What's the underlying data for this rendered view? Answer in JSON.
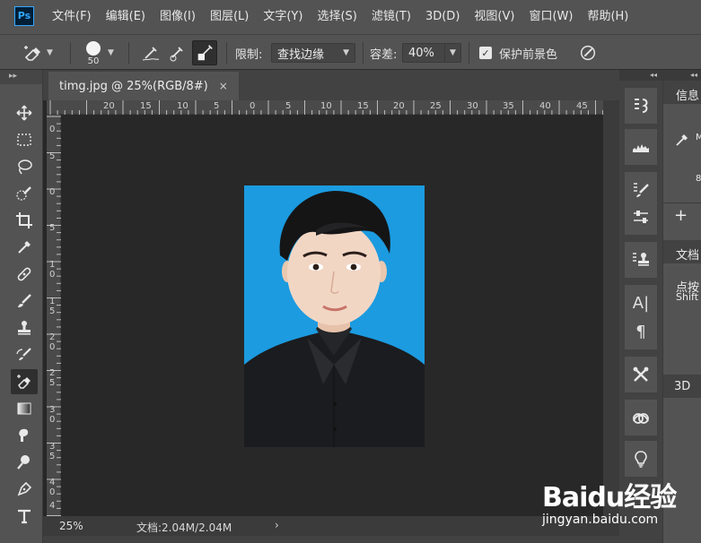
{
  "app": {
    "logo": "Ps"
  },
  "menu": [
    "文件(F)",
    "编辑(E)",
    "图像(I)",
    "图层(L)",
    "文字(Y)",
    "选择(S)",
    "滤镜(T)",
    "3D(D)",
    "视图(V)",
    "窗口(W)",
    "帮助(H)"
  ],
  "options": {
    "brush_size": "50",
    "limit_label": "限制:",
    "limit_value": "查找边缘",
    "tolerance_label": "容差:",
    "tolerance_value": "40%",
    "protect_fg_label": "保护前景色",
    "protect_fg_checked": true
  },
  "toolbar": {
    "collapse": "▸▸"
  },
  "document": {
    "tab_title": "timg.jpg @ 25%(RGB/8#)",
    "close": "×",
    "ruler_h": [
      "20",
      "15",
      "10",
      "5",
      "0",
      "5",
      "10",
      "15",
      "20",
      "25",
      "30",
      "35",
      "40",
      "45"
    ],
    "ruler_v": [
      "0",
      "5",
      "0",
      "5",
      "1",
      "0",
      "1",
      "5",
      "2",
      "0",
      "2",
      "5",
      "3",
      "0",
      "3",
      "5",
      "4",
      "0",
      "4",
      "5"
    ],
    "background_color": "#1c9be0"
  },
  "status": {
    "zoom": "25%",
    "doc_size": "文档:2.04M/2.04M",
    "arrow": "›"
  },
  "dock": {
    "collapse": "◂◂",
    "type_label": "A|",
    "para_label": "¶"
  },
  "panel": {
    "collapse": "◂◂",
    "info_tab": "信息",
    "info_m": "M",
    "info_8": "8",
    "plus": "+",
    "doc_tab": "文档",
    "hint_line1": "点按",
    "hint_line2": "Shift",
    "tab_3d": "3D"
  },
  "watermark": {
    "logo": "Baidu经验",
    "url": "jingyan.baidu.com"
  }
}
